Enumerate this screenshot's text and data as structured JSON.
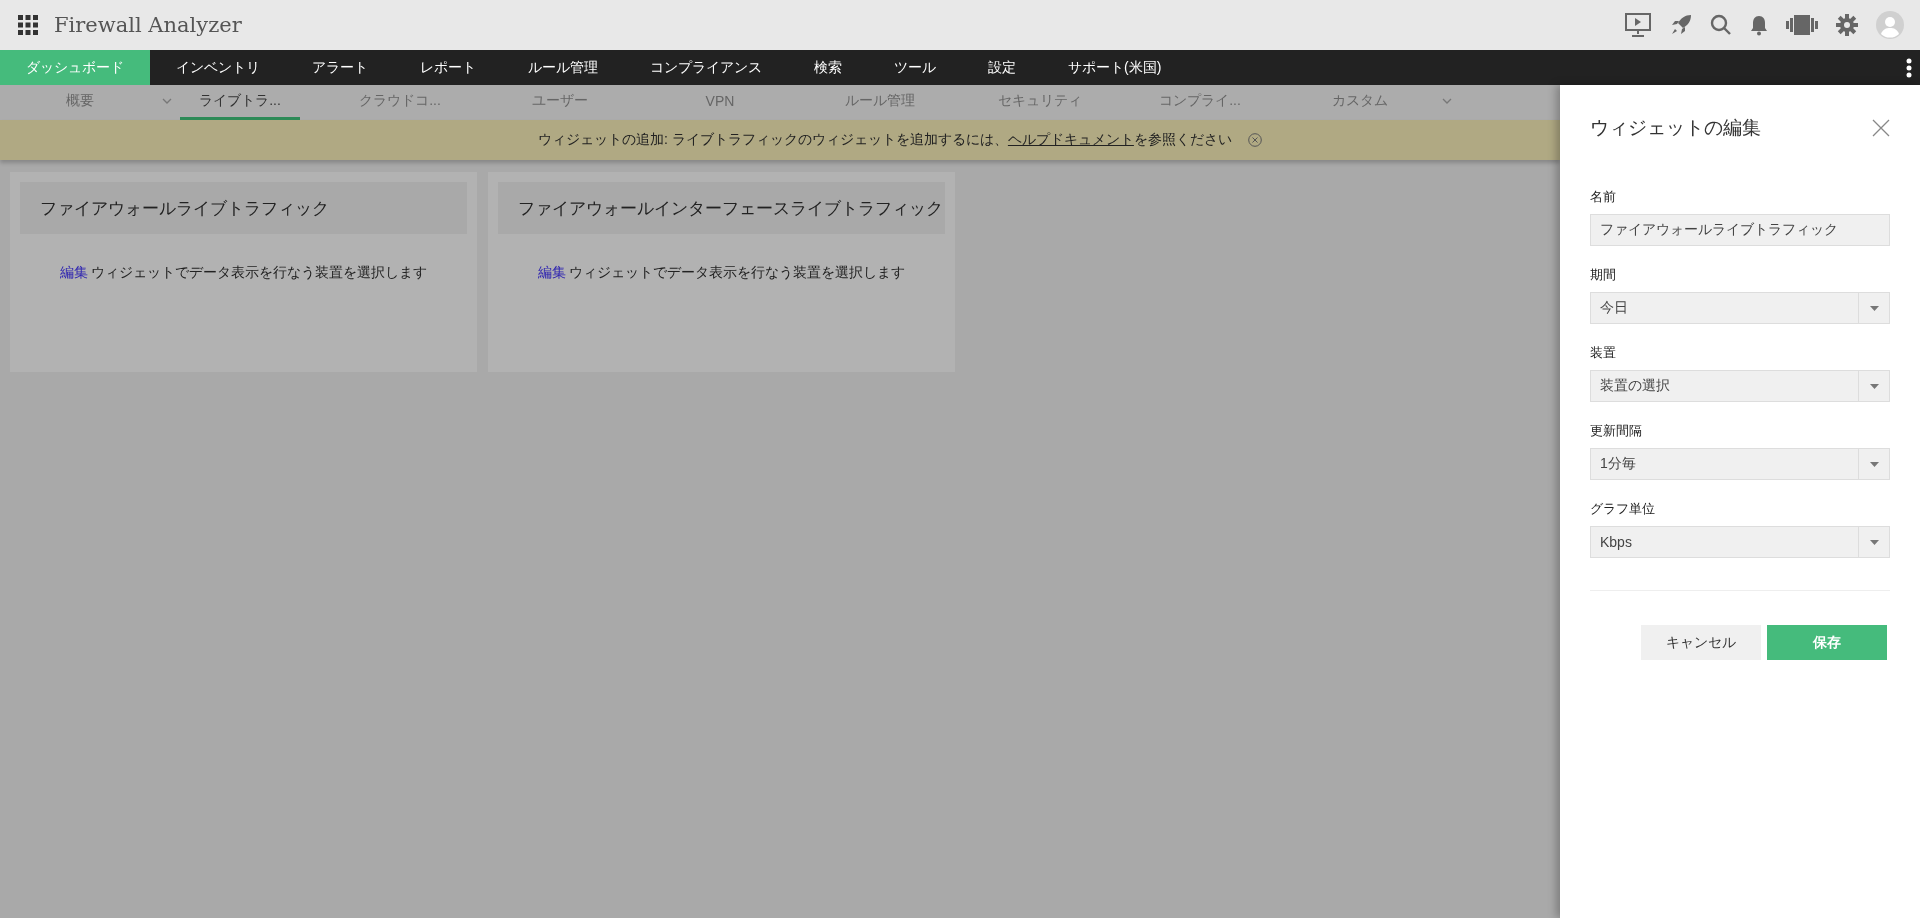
{
  "app": {
    "title": "Firewall Analyzer"
  },
  "nav": [
    {
      "label": "ダッシュボード",
      "selected": true
    },
    {
      "label": "インベントリ",
      "selected": false
    },
    {
      "label": "アラート",
      "selected": false
    },
    {
      "label": "レポート",
      "selected": false
    },
    {
      "label": "ルール管理",
      "selected": false
    },
    {
      "label": "コンプライアンス",
      "selected": false
    },
    {
      "label": "検索",
      "selected": false
    },
    {
      "label": "ツール",
      "selected": false
    },
    {
      "label": "設定",
      "selected": false
    },
    {
      "label": "サポート(米国)",
      "selected": false
    }
  ],
  "subtabs": [
    {
      "label": "概要",
      "selected": false,
      "dropdown": true
    },
    {
      "label": "ライブトラ...",
      "selected": true,
      "dropdown": false
    },
    {
      "label": "クラウドコ...",
      "selected": false,
      "dropdown": false
    },
    {
      "label": "ユーザー",
      "selected": false,
      "dropdown": false
    },
    {
      "label": "VPN",
      "selected": false,
      "dropdown": false
    },
    {
      "label": "ルール管理",
      "selected": false,
      "dropdown": false
    },
    {
      "label": "セキュリティ",
      "selected": false,
      "dropdown": false
    },
    {
      "label": "コンプライ...",
      "selected": false,
      "dropdown": false
    },
    {
      "label": "カスタム",
      "selected": false,
      "dropdown": true
    }
  ],
  "banner": {
    "text_before": "ウィジェットの追加: ライブトラフィックのウィジェットを追加するには、",
    "link": "ヘルプドキュメント",
    "text_after": "を参照ください"
  },
  "widgets": [
    {
      "title": "ファイアウォールライブトラフィック",
      "link": "編集",
      "message": "ウィジェットでデータ表示を行なう装置を選択します"
    },
    {
      "title": "ファイアウォールインターフェースライブトラフィック",
      "link": "編集",
      "message": "ウィジェットでデータ表示を行なう装置を選択します"
    }
  ],
  "panel": {
    "title": "ウィジェットの編集",
    "fields": [
      {
        "label": "名前",
        "kind": "text",
        "value": "ファイアウォールライブトラフィック"
      },
      {
        "label": "期間",
        "kind": "select",
        "value": "今日"
      },
      {
        "label": "装置",
        "kind": "select",
        "value": "装置の選択"
      },
      {
        "label": "更新間隔",
        "kind": "select",
        "value": "1分毎"
      },
      {
        "label": "グラフ単位",
        "kind": "select",
        "value": "Kbps"
      }
    ],
    "cancel": "キャンセル",
    "save": "保存"
  }
}
